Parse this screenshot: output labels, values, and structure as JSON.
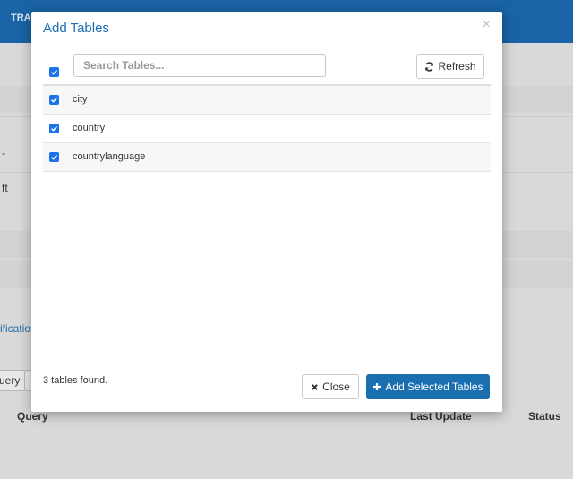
{
  "background": {
    "brand_fragment": "TRA",
    "row_label_1": "-",
    "row_label_2": "ft",
    "notifications_fragment": "ification",
    "query_button_fragment": "uery",
    "table_headers": {
      "query": "Query",
      "last_update": "Last Update",
      "status": "Status"
    }
  },
  "modal": {
    "title": "Add Tables",
    "close_symbol": "×",
    "search": {
      "placeholder": "Search Tables...",
      "value": ""
    },
    "refresh_label": "Refresh",
    "select_all_checked": true,
    "tables": [
      {
        "name": "city",
        "checked": true
      },
      {
        "name": "country",
        "checked": true
      },
      {
        "name": "countrylanguage",
        "checked": true
      }
    ],
    "status_text": "3 tables found.",
    "close_label": "Close",
    "add_label": "Add Selected Tables"
  },
  "colors": {
    "accent": "#1a6fb0",
    "title": "#1b6fb5",
    "checkbox": "#1a73e8",
    "header_bar": "#1a63a6"
  }
}
